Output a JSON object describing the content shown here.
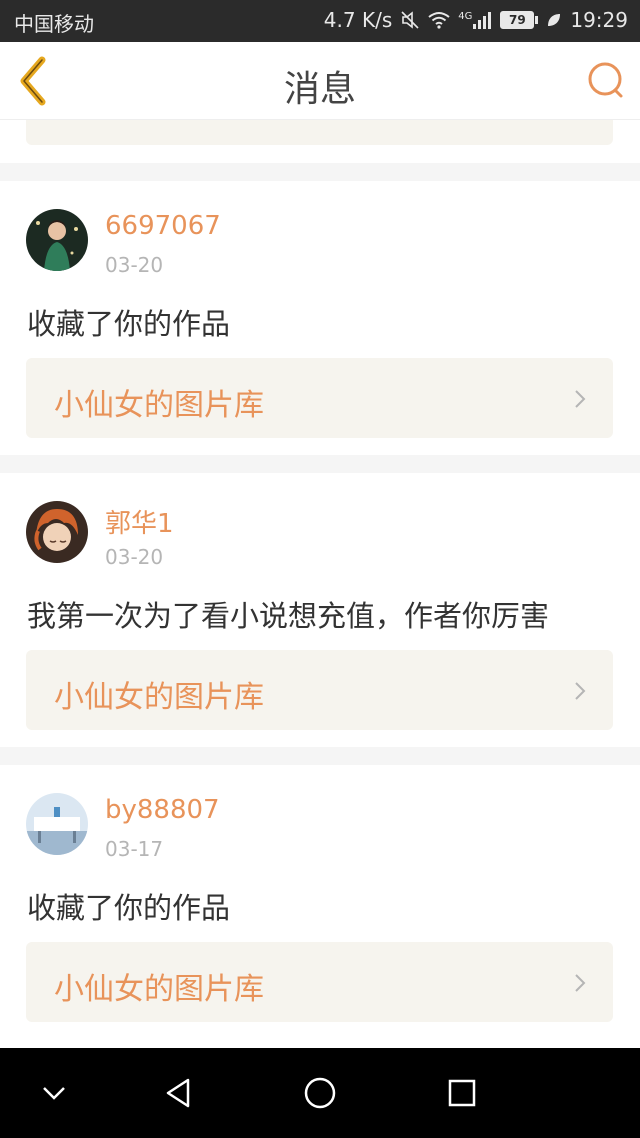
{
  "status_bar": {
    "carrier": "中国移动",
    "speed": "4.7 K/s",
    "network": "4G",
    "battery": "79",
    "time": "19:29"
  },
  "header": {
    "title": "消息"
  },
  "messages": [
    {
      "username": "6697067",
      "date": "03-20",
      "text": "收藏了你的作品",
      "link_label": "小仙女的图片库"
    },
    {
      "username": "郭华1",
      "date": "03-20",
      "text": "我第一次为了看小说想充值，作者你厉害",
      "link_label": "小仙女的图片库"
    },
    {
      "username": "by88807",
      "date": "03-17",
      "text": "收藏了你的作品",
      "link_label": "小仙女的图片库"
    }
  ],
  "colors": {
    "accent": "#e8935a",
    "card_bg": "#f6f4ee",
    "back_icon": "#e6a81f"
  },
  "icons": {
    "back": "chevron-left-icon",
    "search": "search-icon",
    "nav_hide": "chevron-down-icon",
    "nav_back": "triangle-back-icon",
    "nav_home": "circle-home-icon",
    "nav_recent": "square-recent-icon"
  }
}
